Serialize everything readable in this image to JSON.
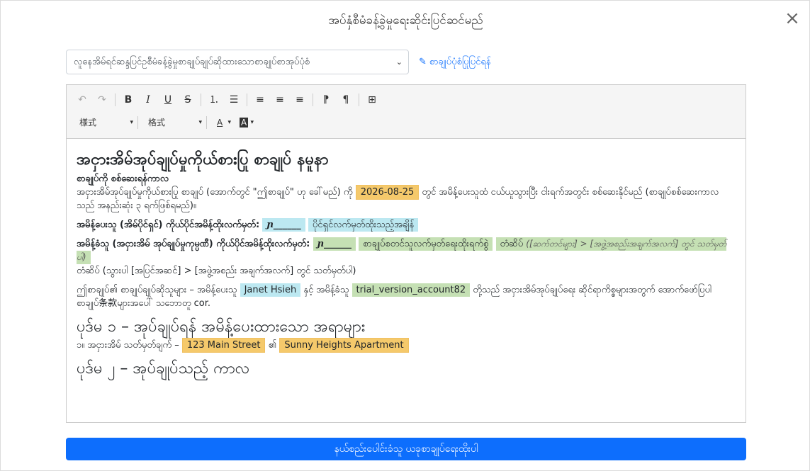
{
  "modal": {
    "title": "အပ်နှံစီမံခန့်ခွဲမှုရေးဆိုင်းပြင်ဆင်မည်",
    "close_symbol": "×"
  },
  "template_select": {
    "value": "လူနေအိမ်ရင်ဆန္ဒပြင်ဥစီမံခန့်ခွဲမှုစာချုပ်ချုပ်ဆိုထားသောစာချုပ်စာအုပ်ပုံစံ",
    "caret": "⌄"
  },
  "edit_link": {
    "icon": "✎",
    "label": "စာချုပ်ပုံစံပြုပြင်ရန်"
  },
  "toolbar": {
    "undo": "↶",
    "redo": "↷",
    "bold": "B",
    "italic": "I",
    "underline": "U",
    "strike": "S",
    "ordered_list": "⒈",
    "bullet_list": "☰",
    "align_left": "≡",
    "align_center": "≡",
    "align_right": "≡",
    "ltr": "⁋",
    "rtl": "¶",
    "table": "⊞",
    "style_label": "様式",
    "format_label": "格式",
    "font_color": "A",
    "bg_color": "A",
    "combo_caret": "▾"
  },
  "document": {
    "title": "အငှားအိမ်အုပ်ချုပ်မှုကိုယ်စားပြု စာချုပ် နမူနာ",
    "check_period_heading": "စာချုပ်ကို စစ်ဆေးရန်ကာလ",
    "para1_a": "အငှားအိမ်အုပ်ချုပ်မှုကိုယ်စားပြု စာချုပ် (အောက်တွင် \"ဤစာချုပ်\" ဟု ခေါ်မည်) ကို",
    "date": "2026-08-25",
    "para1_b": "တွင် အမိန့်ပေးသူထံ ငယ်ယူသွားပြီး ငါးရက်အတွင်း စစ်ဆေးနိုင်မည် (စာချုပ်စစ်ဆေးကာလသည် အနည်းဆုံး ၃ ရက်ဖြစ်ရမည်)။",
    "owner_sig_label": "အမိန့်ပေးသူ (အိမ်ပိုင်ရှင်) ကိုယ်ပိုင်အမိန့်ထိုးလက်မှတ်:",
    "owner_sig_mark": "ɲ______",
    "owner_sig_note": "ပိုင်ရှင်လက်မှတ်ထိုးသည့်အချိန်",
    "agent_sig_label": "အမိန့်ခံသူ (အငှားအိမ် အုပ်ချုပ်မှုကုမ္ပဏီ) ကိုယ်ပိုင်အမိန့်ထိုးလက်မှတ်:",
    "agent_sig_mark": "ɲ______",
    "agent_sig_note": "စာချုပ်စတင်သူလက်မှတ်ရေးထိုးရက်စွဲ",
    "agent_sig_hint_a": "တံဆိပ်",
    "agent_sig_hint_b": "([ဆက်တင်များ] > [အဖွဲ့အစည်းအချက်အလက်] တွင် သတ်မှတ်ပါ)",
    "stamp_line": "တံဆိပ် (သွားပါ [အပြင်အဆင်] > [အဖွဲ့အစည်း အချက်အလက်] တွင် သတ်မှတ်ပါ)",
    "parties_a": "ဤစာချုပ်၏ စာချုပ်ချုပ်ဆိုသူများ – အမိန့်ပေးသူ",
    "owner_name": "Janet Hsieh",
    "parties_b": "နှင့် အမိန့်ခံသူ",
    "agent_name": "trial_version_account82",
    "parties_c": "တို့သည် အငှားအိမ်အုပ်ချုပ်ရေး ဆိုင်ရာကိစ္စများအတွက် အောက်ဖော်ပြပါ စာချုပ်条款များအပေါ် သဘောတူ cor.",
    "section1_title": "ပုဒ်မ ၁ – အုပ်ချုပ်ရန် အမိန့်ပေးထားသော အရာများ",
    "section1_item": "၁။ အငှားအိမ် သတ်မှတ်ချက် –",
    "address": "123 Main Street",
    "of": "၏",
    "building": "Sunny Heights Apartment",
    "section2_title": "ပုဒ်မ ၂ – အုပ်ချုပ်သည့် ကာလ"
  },
  "submit_button": {
    "label": "နယ်စည်းပေါင်းခံသူ ယခုစာချုပ်ရေးထိုးပါ"
  }
}
